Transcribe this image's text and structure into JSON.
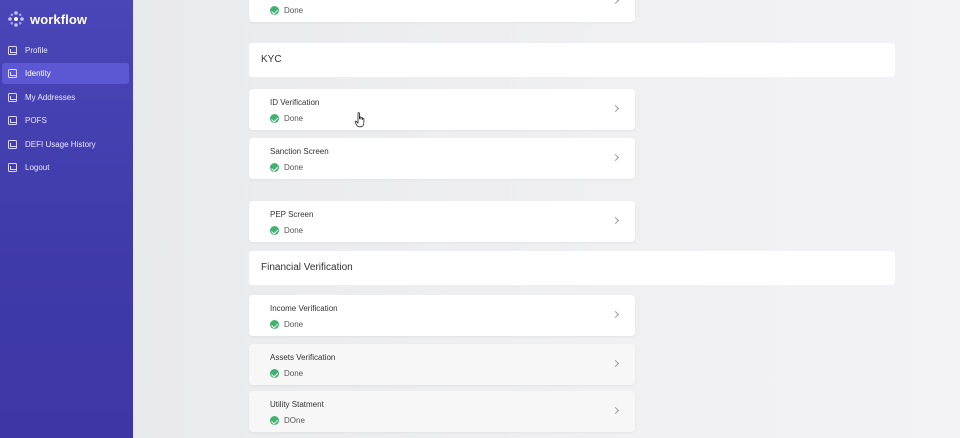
{
  "app": {
    "brand": "workflow",
    "accent": "#4a46b8"
  },
  "sidebar": {
    "items": [
      {
        "label": "Profile",
        "active": false
      },
      {
        "label": "Identity",
        "active": true
      },
      {
        "label": "My Addresses",
        "active": false
      },
      {
        "label": "POFS",
        "active": false
      },
      {
        "label": "DEFI Usage History",
        "active": false
      },
      {
        "label": "Logout",
        "active": false
      }
    ]
  },
  "main": {
    "top_card": {
      "status": "Done"
    },
    "kyc": {
      "title": "KYC",
      "items": [
        {
          "title": "ID Verification",
          "status": "Done"
        },
        {
          "title": "Sanction Screen",
          "status": "Done"
        },
        {
          "title": "PEP Screen",
          "status": "Done"
        }
      ]
    },
    "financial": {
      "title": "Financial Verification",
      "items": [
        {
          "title": "Income Verification",
          "status": "Done"
        },
        {
          "title": "Assets Verification",
          "status": "Done"
        },
        {
          "title": "Utility Statment",
          "status": "DOne"
        }
      ]
    }
  }
}
